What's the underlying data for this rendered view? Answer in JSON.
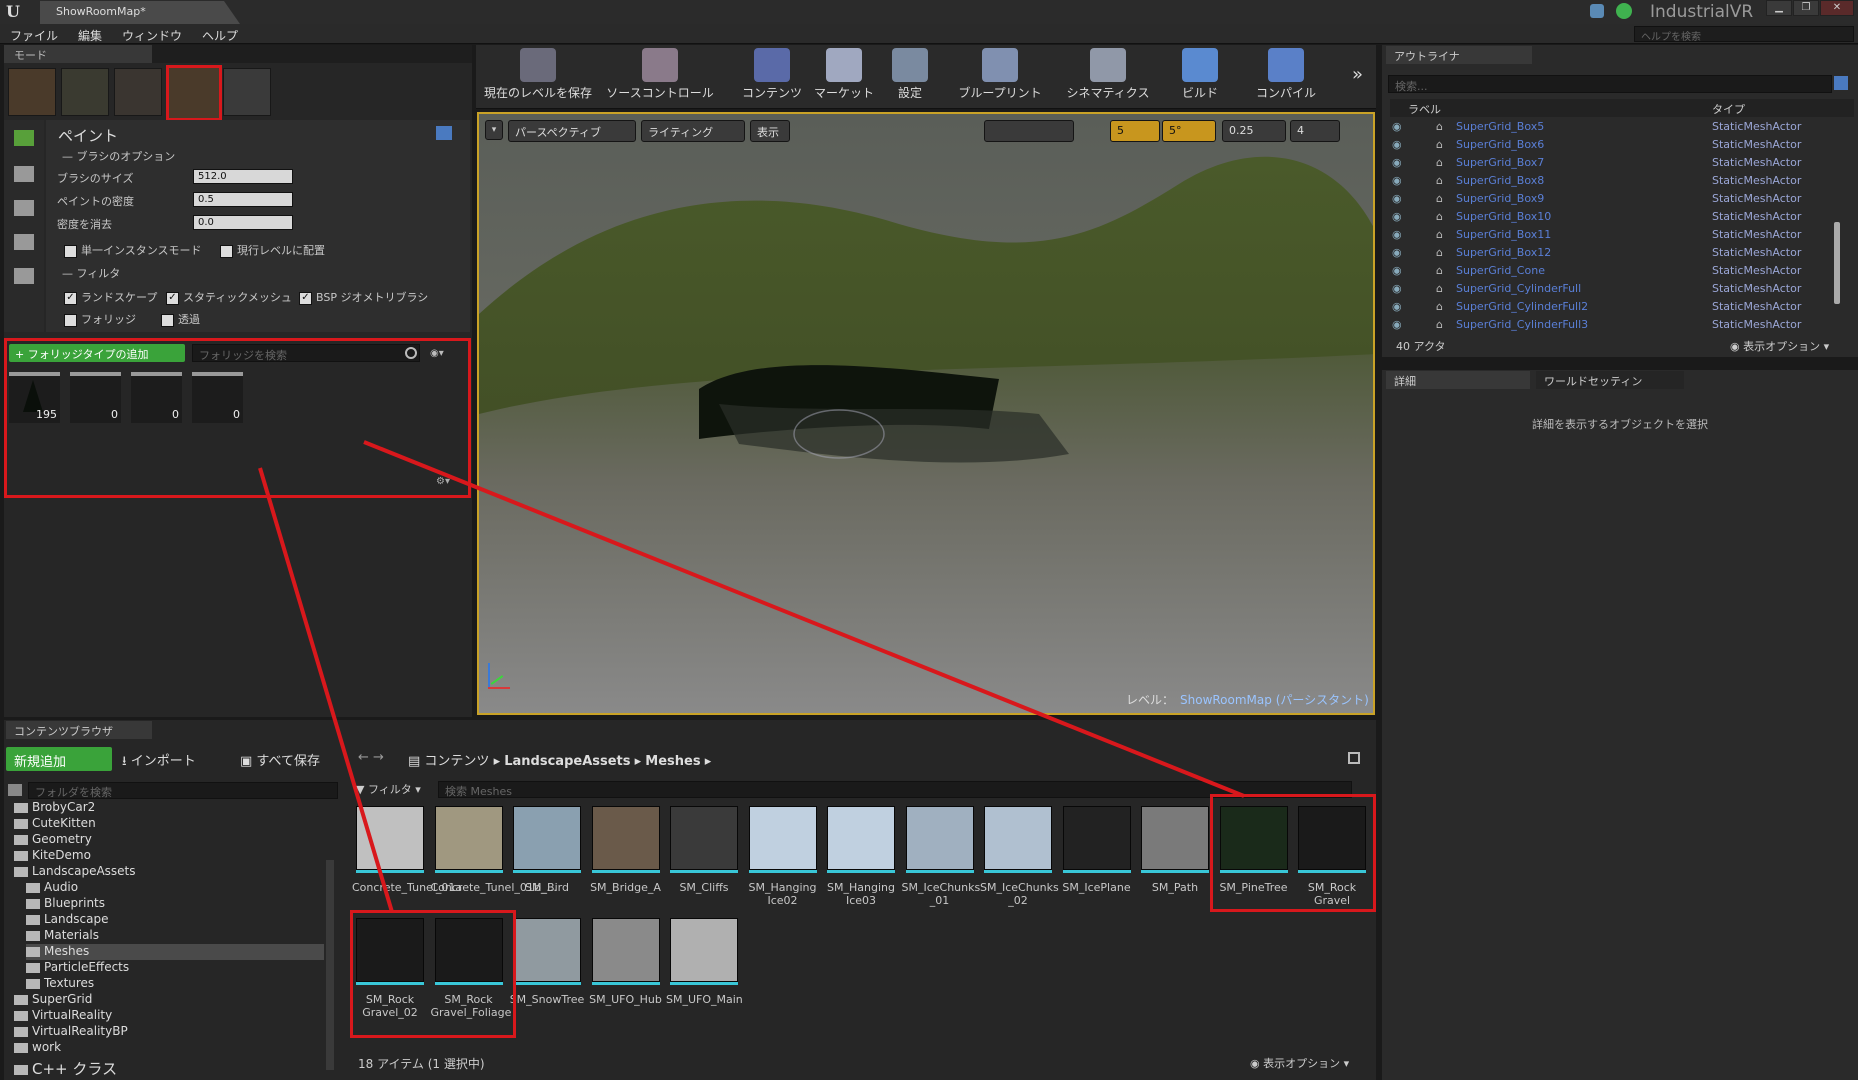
{
  "window": {
    "tab_title": "ShowRoomMap*",
    "project": "IndustrialVR",
    "help_placeholder": "ヘルプを検索",
    "min": "▁",
    "max": "❐",
    "close": "✕"
  },
  "menu": [
    "ファイル",
    "編集",
    "ウィンドウ",
    "ヘルプ"
  ],
  "modes": {
    "tab": "モード",
    "paint_label": "ペイント",
    "brush_options": "ブラシのオプション",
    "brush_size_label": "ブラシのサイズ",
    "brush_size": "512.0",
    "paint_density_label": "ペイントの密度",
    "paint_density": "0.5",
    "erase_density_label": "密度を消去",
    "erase_density": "0.0",
    "single_instance": "単一インスタンスモード",
    "place_current_level": "現行レベルに配置",
    "filter_label": "フィルタ",
    "f_landscape": "ランドスケープ",
    "f_static": "スタティックメッシュ",
    "f_bsp": "BSP ジオメトリブラシ",
    "f_foliage": "フォリッジ",
    "f_translucent": "透過",
    "add_foliage": "+ フォリッジタイプの追加",
    "foliage_search": "フォリッジを検索",
    "foliage_counts": [
      "195",
      "0",
      "0",
      "0"
    ]
  },
  "toolbar": [
    "現在のレベルを保存",
    "ソースコントロール",
    "コンテンツ",
    "マーケット",
    "設定",
    "ブループリント",
    "シネマティクス",
    "ビルド",
    "コンパイル"
  ],
  "viewport": {
    "perspective": "パースペクティブ",
    "lighting": "ライティング",
    "show": "表示",
    "grid": "5",
    "angle": "5°",
    "scale": "0.25",
    "speed": "4",
    "level_label": "レベル：",
    "level_name": "ShowRoomMap (パーシスタント)"
  },
  "outliner": {
    "tab": "アウトライナ",
    "search": "検索...",
    "col_label": "ラベル",
    "col_type": "タイプ",
    "rows": [
      {
        "name": "SuperGrid_Box5",
        "type": "StaticMeshActor"
      },
      {
        "name": "SuperGrid_Box6",
        "type": "StaticMeshActor"
      },
      {
        "name": "SuperGrid_Box7",
        "type": "StaticMeshActor"
      },
      {
        "name": "SuperGrid_Box8",
        "type": "StaticMeshActor"
      },
      {
        "name": "SuperGrid_Box9",
        "type": "StaticMeshActor"
      },
      {
        "name": "SuperGrid_Box10",
        "type": "StaticMeshActor"
      },
      {
        "name": "SuperGrid_Box11",
        "type": "StaticMeshActor"
      },
      {
        "name": "SuperGrid_Box12",
        "type": "StaticMeshActor"
      },
      {
        "name": "SuperGrid_Cone",
        "type": "StaticMeshActor"
      },
      {
        "name": "SuperGrid_CylinderFull",
        "type": "StaticMeshActor"
      },
      {
        "name": "SuperGrid_CylinderFull2",
        "type": "StaticMeshActor"
      },
      {
        "name": "SuperGrid_CylinderFull3",
        "type": "StaticMeshActor"
      }
    ],
    "count": "40 アクタ",
    "view_options": "表示オプション"
  },
  "details": {
    "tab1": "詳細",
    "tab2": "ワールドセッティン",
    "empty": "詳細を表示するオブジェクトを選択"
  },
  "content": {
    "tab": "コンテンツブラウザ",
    "add_new": "新規追加",
    "import": "インポート",
    "save_all": "すべて保存",
    "crumb": [
      "コンテンツ",
      "LandscapeAssets",
      "Meshes"
    ],
    "folder_search": "フォルダを検索",
    "filter": "フィルタ",
    "search_meshes": "検索 Meshes",
    "tree": [
      "BrobyCar2",
      "CuteKitten",
      "Geometry",
      "KiteDemo",
      "LandscapeAssets",
      "Audio",
      "Blueprints",
      "Landscape",
      "Materials",
      "Meshes",
      "ParticleEffects",
      "Textures",
      "SuperGrid",
      "VirtualReality",
      "VirtualRealityBP",
      "work"
    ],
    "cpp": "C++ クラス",
    "assets_row1": [
      "Concrete_Tunel_01a",
      "Concrete_Tunel_01b_...",
      "SM_Bird",
      "SM_Bridge_A",
      "SM_Cliffs",
      "SM_Hanging Ice02",
      "SM_Hanging Ice03",
      "SM_IceChunks _01",
      "SM_IceChunks _02",
      "SM_IcePlane",
      "SM_Path",
      "SM_PineTree",
      "SM_Rock Gravel"
    ],
    "assets_row2": [
      "SM_Rock Gravel_02",
      "SM_Rock Gravel_Foliage",
      "SM_SnowTree",
      "SM_UFO_Hub",
      "SM_UFO_Main"
    ],
    "status": "18 アイテム (1 選択中)",
    "view_options": "表示オプション"
  },
  "colors": {
    "accent_red": "#d8181c",
    "add_green": "#3aa33a",
    "teal": "#39c7d8"
  }
}
